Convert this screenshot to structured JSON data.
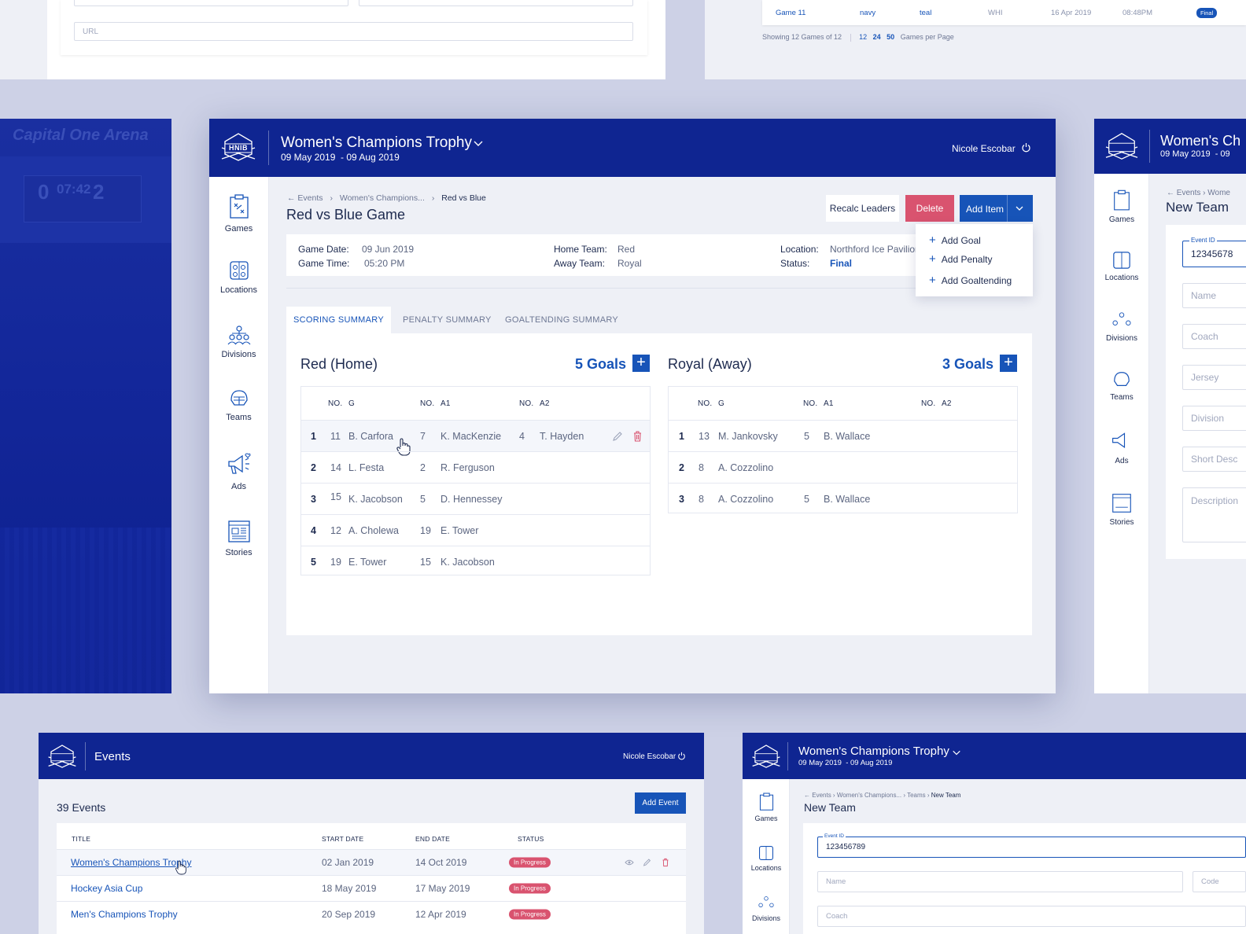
{
  "colors": {
    "navy": "#0f2591",
    "accent": "#1754b8",
    "danger": "#d9536f",
    "bg": "#cdd1e6"
  },
  "brand": {
    "logo_text": "HNIB"
  },
  "top_left_panel": {
    "url_placeholder": "URL"
  },
  "top_right_panel": {
    "game_row": {
      "name": "Game 11",
      "home": "navy",
      "away": "teal",
      "location": "WHI",
      "date": "16 Apr 2019",
      "time": "08:48PM",
      "status": "Final"
    },
    "showing": "Showing 12 Games of 12",
    "per_page_options": [
      "12",
      "24",
      "50"
    ],
    "per_page_label": "Games per Page"
  },
  "arena_banner": {
    "sign": "Capital One Arena",
    "score_left": "0",
    "clock": "07:42",
    "score_right": "2"
  },
  "main": {
    "header": {
      "title": "Women's Champions Trophy",
      "dates": "09 May 2019  - 09 Aug 2019",
      "user": "Nicole Escobar"
    },
    "sidebar": [
      {
        "label": "Games",
        "icon": "clipboard-play-icon"
      },
      {
        "label": "Locations",
        "icon": "rink-icon"
      },
      {
        "label": "Divisions",
        "icon": "hierarchy-icon"
      },
      {
        "label": "Teams",
        "icon": "helmet-icon"
      },
      {
        "label": "Ads",
        "icon": "megaphone-icon"
      },
      {
        "label": "Stories",
        "icon": "newspaper-icon"
      }
    ],
    "breadcrumb": {
      "back": "Events",
      "mid": "Women's Champions...",
      "current": "Red vs Blue"
    },
    "page_title": "Red vs Blue Game",
    "buttons": {
      "recalc": "Recalc Leaders",
      "delete": "Delete",
      "add_item": "Add Item"
    },
    "dropdown": [
      "Add Goal",
      "Add Penalty",
      "Add Goaltending"
    ],
    "info": {
      "game_date_label": "Game Date:",
      "game_date": "09 Jun 2019",
      "game_time_label": "Game Time:",
      "game_time": "05:20 PM",
      "home_label": "Home Team:",
      "home": "Red",
      "away_label": "Away Team:",
      "away": "Royal",
      "location_label": "Location:",
      "location": "Northford Ice Pavilion",
      "status_label": "Status:",
      "status": "Final"
    },
    "tabs": [
      "SCORING SUMMARY",
      "PENALTY SUMMARY",
      "GOALTENDING SUMMARY"
    ],
    "col_headers": {
      "no": "NO.",
      "g": "G",
      "a1": "A1",
      "a2": "A2"
    },
    "home_team": {
      "title": "Red (Home)",
      "goals": "5 Goals",
      "rows": [
        {
          "n": "1",
          "gno": "11",
          "g": "B. Carfora",
          "a1no": "7",
          "a1": "K. MacKenzie",
          "a2no": "4",
          "a2": "T. Hayden"
        },
        {
          "n": "2",
          "gno": "14",
          "g": "L. Festa",
          "a1no": "2",
          "a1": "R. Ferguson",
          "a2no": "",
          "a2": ""
        },
        {
          "n": "3",
          "gno": "15",
          "g": "K. Jacobson",
          "a1no": "5",
          "a1": "D. Hennessey",
          "a2no": "",
          "a2": ""
        },
        {
          "n": "4",
          "gno": "12",
          "g": "A. Cholewa",
          "a1no": "19",
          "a1": "E. Tower",
          "a2no": "",
          "a2": ""
        },
        {
          "n": "5",
          "gno": "19",
          "g": "E. Tower",
          "a1no": "15",
          "a1": "K. Jacobson",
          "a2no": "",
          "a2": ""
        }
      ]
    },
    "away_team": {
      "title": "Royal (Away)",
      "goals": "3 Goals",
      "rows": [
        {
          "n": "1",
          "gno": "13",
          "g": "M. Jankovsky",
          "a1no": "5",
          "a1": "B. Wallace"
        },
        {
          "n": "2",
          "gno": "8",
          "g": "A. Cozzolino",
          "a1no": "",
          "a1": ""
        },
        {
          "n": "3",
          "gno": "8",
          "g": "A. Cozzolino",
          "a1no": "5",
          "a1": "B. Wallace"
        }
      ]
    }
  },
  "right_panel": {
    "title": "Women's Ch",
    "dates": "09 May 2019  - 09",
    "breadcrumb": "Events",
    "breadcrumb_next": "Wome",
    "page_title": "New Team",
    "event_id_label": "Event ID",
    "event_id": "12345678",
    "fields": [
      "Name",
      "Coach",
      "Jersey",
      "Division",
      "Short Desc",
      "Description"
    ],
    "sidebar": [
      "Games",
      "Locations",
      "Divisions",
      "Teams",
      "Ads",
      "Stories"
    ]
  },
  "events_panel": {
    "header": "Events",
    "user": "Nicole Escobar",
    "count": "39 Events",
    "add_button": "Add Event",
    "columns": [
      "TITLE",
      "START DATE",
      "END DATE",
      "STATUS"
    ],
    "rows": [
      {
        "title": "Women's Champions Trophy",
        "start": "02 Jan 2019",
        "end": "14 Oct 2019",
        "status": "In Progress"
      },
      {
        "title": "Hockey Asia Cup",
        "start": "18 May 2019",
        "end": "17 May 2019",
        "status": "In Progress"
      },
      {
        "title": "Men's Champions Trophy",
        "start": "20 Sep 2019",
        "end": "12 Apr 2019",
        "status": "In Progress"
      }
    ]
  },
  "newteam_panel": {
    "title": "Women's Champions Trophy",
    "dates": "09 May 2019  - 09 Aug 2019",
    "breadcrumb": [
      "Events",
      "Women's Champions...",
      "Teams",
      "New Team"
    ],
    "page_title": "New Team",
    "event_id_label": "Event ID",
    "event_id": "123456789",
    "fields": [
      "Name",
      "Code",
      "Coach"
    ],
    "sidebar": [
      "Games",
      "Locations",
      "Divisions"
    ]
  }
}
